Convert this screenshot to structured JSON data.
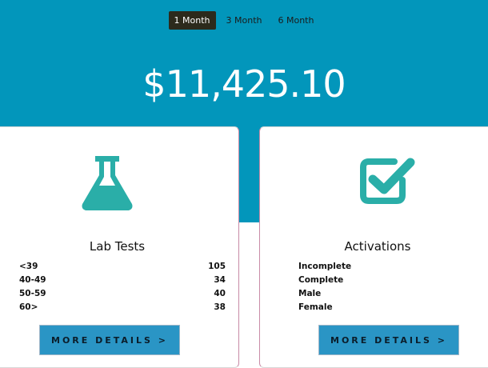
{
  "period_tabs": [
    {
      "label": "1 Month",
      "active": true
    },
    {
      "label": "3 Month",
      "active": false
    },
    {
      "label": "6 Month",
      "active": false
    }
  ],
  "summary": {
    "amount": "$11,425.10"
  },
  "colors": {
    "hero_bg": "#0296bb",
    "icon_teal": "#2aaea8",
    "button_bg": "#2a95c5",
    "active_tab": "#2c2a1c"
  },
  "lab_tests": {
    "icon": "flask-icon",
    "title": "Lab Tests",
    "rows": [
      {
        "label": "<39",
        "value": "105"
      },
      {
        "label": "40-49",
        "value": "34"
      },
      {
        "label": "50-59",
        "value": "40"
      },
      {
        "label": "60>",
        "value": "38"
      }
    ],
    "button_label": "MORE DETAILS >"
  },
  "activations": {
    "icon": "checkbox-checked-icon",
    "title": "Activations",
    "rows": [
      {
        "label": "Incomplete"
      },
      {
        "label": "Complete"
      },
      {
        "label": "Male"
      },
      {
        "label": "Female"
      }
    ],
    "button_label": "MORE DETAILS >"
  }
}
